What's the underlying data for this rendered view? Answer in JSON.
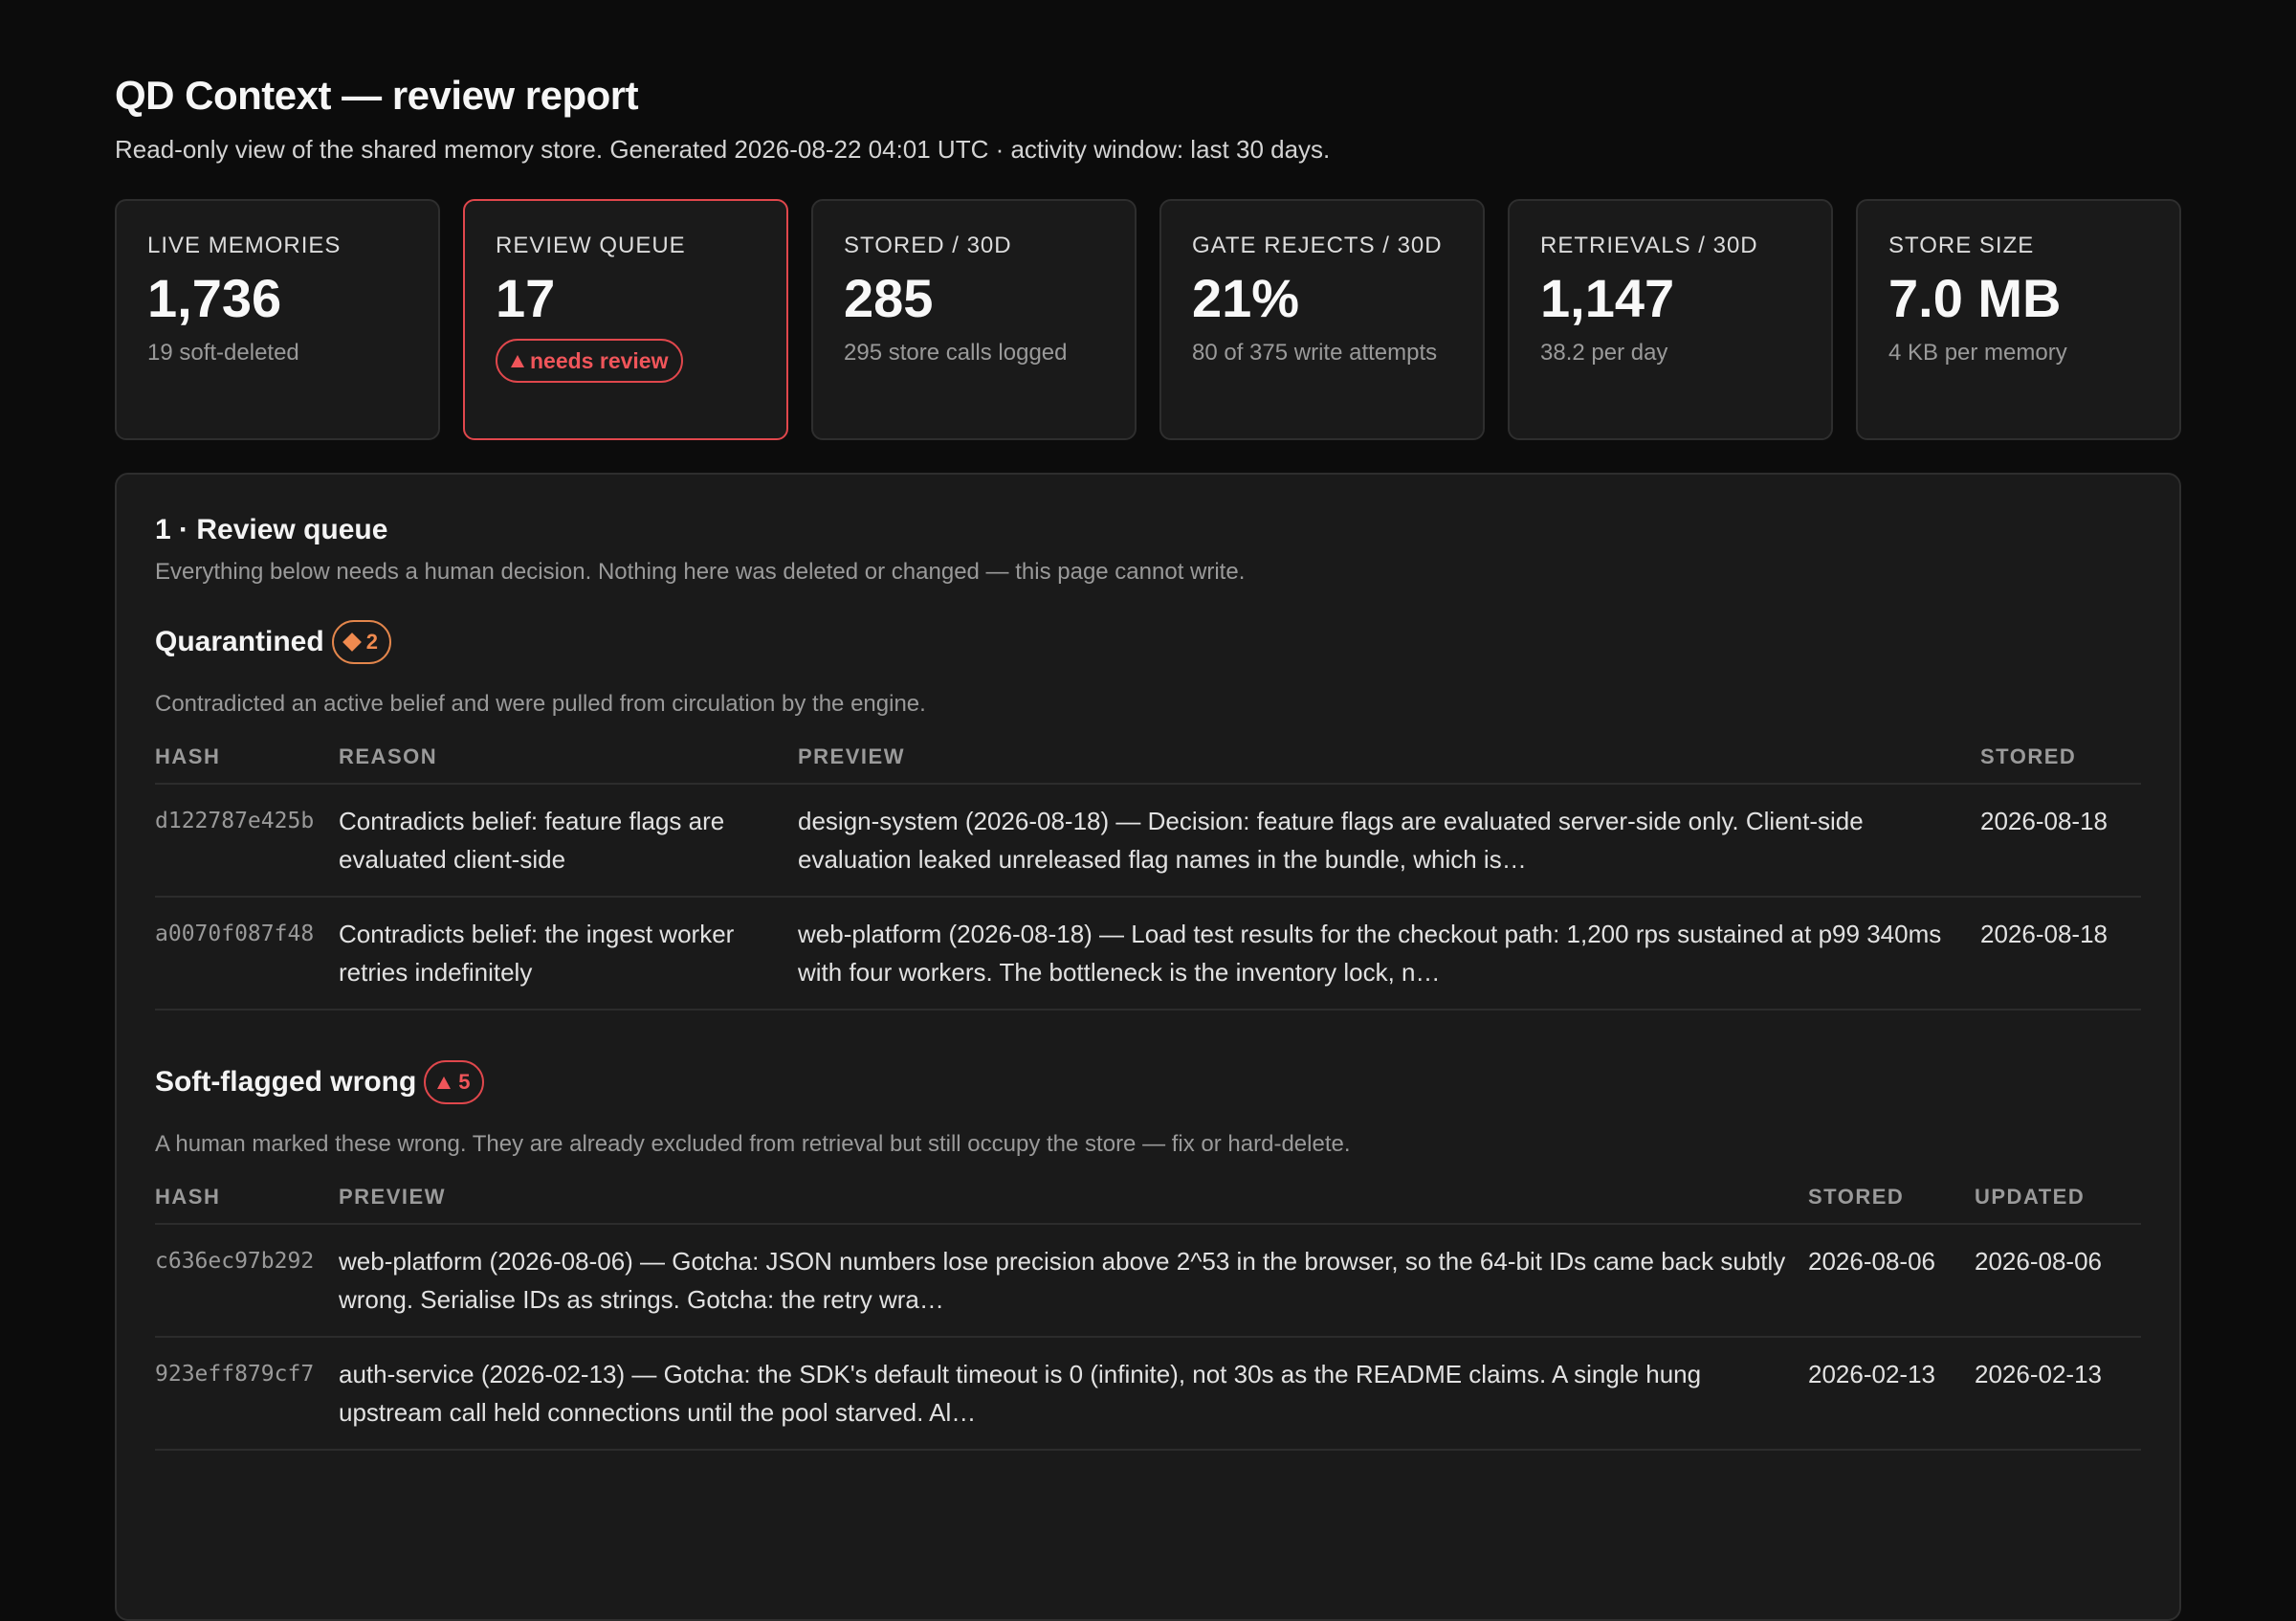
{
  "header": {
    "title": "QD Context — review report",
    "subtitle": "Read-only view of the shared memory store. Generated 2026-08-22 04:01 UTC · activity window: last 30 days."
  },
  "cards": [
    {
      "label": "LIVE MEMORIES",
      "value": "1,736",
      "sub": "19 soft-deleted"
    },
    {
      "label": "REVIEW QUEUE",
      "value": "17",
      "pill": "needs review"
    },
    {
      "label": "STORED / 30D",
      "value": "285",
      "sub": "295 store calls logged"
    },
    {
      "label": "GATE REJECTS / 30D",
      "value": "21%",
      "sub": "80 of 375 write attempts"
    },
    {
      "label": "RETRIEVALS / 30D",
      "value": "1,147",
      "sub": "38.2 per day"
    },
    {
      "label": "STORE SIZE",
      "value": "7.0 MB",
      "sub": "4 KB per memory"
    }
  ],
  "review": {
    "title": "1 · Review queue",
    "description": "Everything below needs a human decision. Nothing here was deleted or changed — this page cannot write.",
    "quarantined": {
      "title": "Quarantined",
      "count": "2",
      "description": "Contradicted an active belief and were pulled from circulation by the engine.",
      "columns": [
        "HASH",
        "REASON",
        "PREVIEW",
        "STORED"
      ],
      "rows": [
        {
          "hash": "d122787e425b",
          "reason": "Contradicts belief: feature flags are evaluated client-side",
          "preview": "design-system (2026-08-18) — Decision: feature flags are evaluated server-side only. Client-side evaluation leaked unreleased flag names in the bundle, which is…",
          "stored": "2026-08-18"
        },
        {
          "hash": "a0070f087f48",
          "reason": "Contradicts belief: the ingest worker retries indefinitely",
          "preview": "web-platform (2026-08-18) — Load test results for the checkout path: 1,200 rps sustained at p99 340ms with four workers. The bottleneck is the inventory lock, n…",
          "stored": "2026-08-18"
        }
      ]
    },
    "soft_flagged": {
      "title": "Soft-flagged wrong",
      "count": "5",
      "description": "A human marked these wrong. They are already excluded from retrieval but still occupy the store — fix or hard-delete.",
      "columns": [
        "HASH",
        "PREVIEW",
        "STORED",
        "UPDATED"
      ],
      "rows": [
        {
          "hash": "c636ec97b292",
          "preview": "web-platform (2026-08-06) — Gotcha: JSON numbers lose precision above 2^53 in the browser, so the 64-bit IDs came back subtly wrong. Serialise IDs as strings. Gotcha: the retry wra…",
          "stored": "2026-08-06",
          "updated": "2026-08-06"
        },
        {
          "hash": "923eff879cf7",
          "preview": "auth-service (2026-02-13) — Gotcha: the SDK's default timeout is 0 (infinite), not 30s as the README claims. A single hung upstream call held connections until the pool starved. Al…",
          "stored": "2026-02-13",
          "updated": "2026-02-13"
        }
      ]
    }
  }
}
